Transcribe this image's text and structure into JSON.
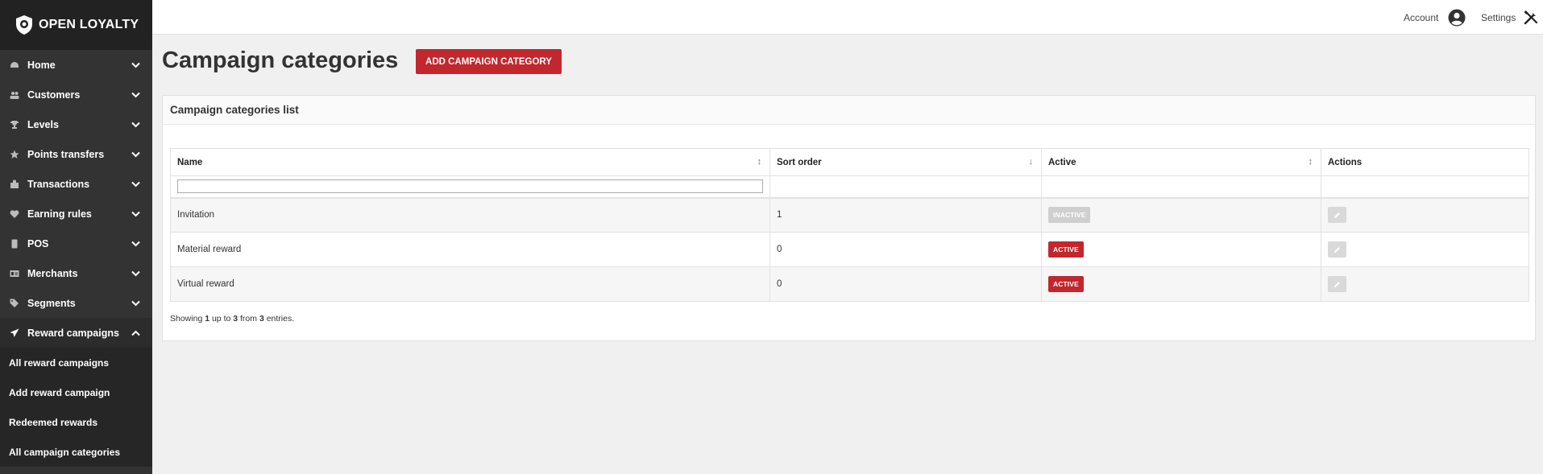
{
  "app": {
    "logo_text": "OPEN LOYALTY"
  },
  "topbar": {
    "account_label": "Account",
    "settings_label": "Settings"
  },
  "sidebar": {
    "items": [
      {
        "label": "Home",
        "icon": "dashboard-icon"
      },
      {
        "label": "Customers",
        "icon": "users-icon"
      },
      {
        "label": "Levels",
        "icon": "trophy-icon"
      },
      {
        "label": "Points transfers",
        "icon": "star-icon"
      },
      {
        "label": "Transactions",
        "icon": "shopping-bag-icon"
      },
      {
        "label": "Earning rules",
        "icon": "heart-icon"
      },
      {
        "label": "POS",
        "icon": "pos-icon"
      },
      {
        "label": "Merchants",
        "icon": "id-card-icon"
      },
      {
        "label": "Segments",
        "icon": "tags-icon"
      },
      {
        "label": "Reward campaigns",
        "icon": "paper-plane-icon"
      }
    ],
    "submenu": [
      {
        "label": "All reward campaigns"
      },
      {
        "label": "Add reward campaign"
      },
      {
        "label": "Redeemed rewards"
      },
      {
        "label": "All campaign categories"
      }
    ]
  },
  "main": {
    "title": "Campaign categories",
    "add_button": "ADD CAMPAIGN CATEGORY",
    "panel_title": "Campaign categories list",
    "table": {
      "headers": {
        "name": "Name",
        "sort_order": "Sort order",
        "active": "Active",
        "actions": "Actions"
      },
      "sort_icons": {
        "name": "↕",
        "sort_order": "↓",
        "active": "↕"
      },
      "filter_placeholder": "",
      "rows": [
        {
          "name": "Invitation",
          "sort_order": "1",
          "status": "INACTIVE"
        },
        {
          "name": "Material reward",
          "sort_order": "0",
          "status": "ACTIVE"
        },
        {
          "name": "Virtual reward",
          "sort_order": "0",
          "status": "ACTIVE"
        }
      ]
    },
    "footer": {
      "prefix": "Showing",
      "from": "1",
      "mid1": "up to",
      "to": "3",
      "mid2": "from",
      "total": "3",
      "suffix": "entries."
    }
  },
  "colors": {
    "accent": "#c1272d",
    "sidebar": "#333333",
    "sidebar_logo": "#222222",
    "inactive_badge": "#cfcfcf"
  }
}
